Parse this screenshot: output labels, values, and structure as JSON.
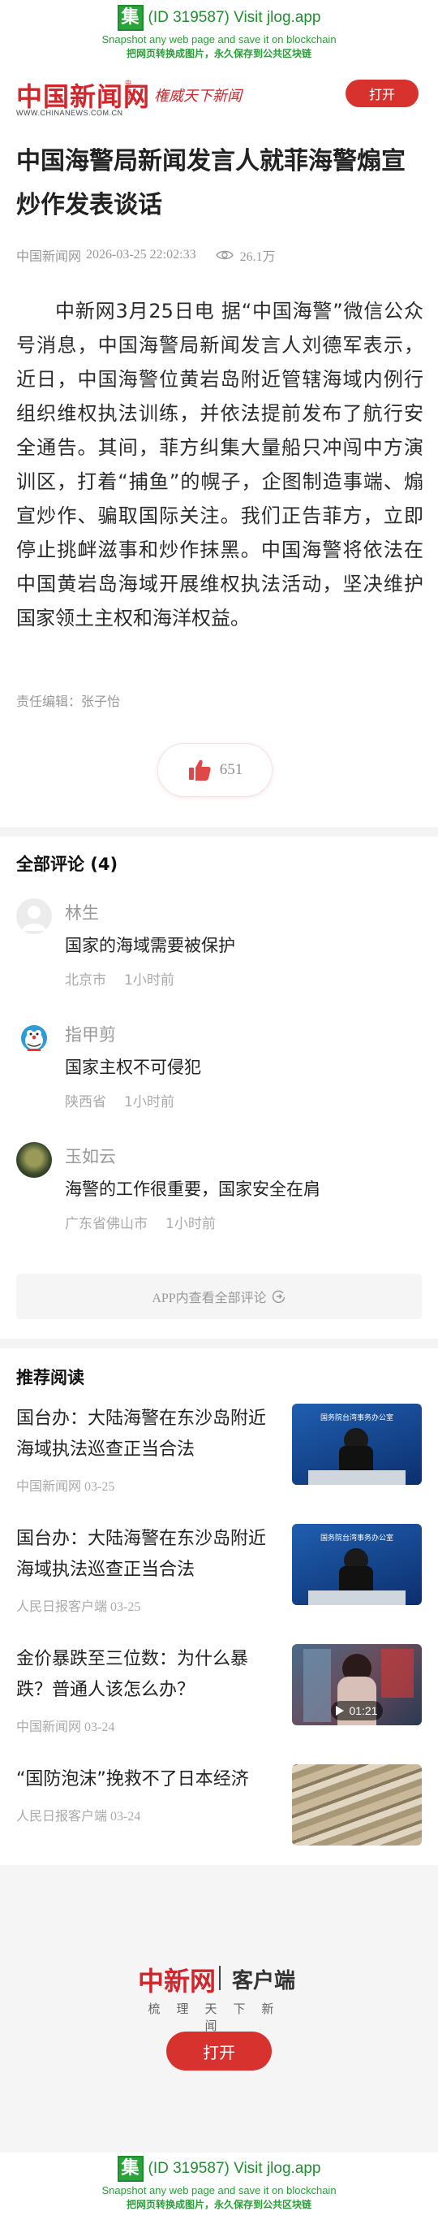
{
  "jlog": {
    "logo_char": "集",
    "id_text": "(ID 319587) Visit jlog.app",
    "line1": "Snapshot any web page and save it on blockchain",
    "line2": "把网页转换成图片，永久保存到公共区块链"
  },
  "header": {
    "logo_text": "中国新闻网",
    "logo_vertical": "中新网",
    "logo_url": "WWW.CHINANEWS.COM.CN",
    "slogan": "権威天下新闻",
    "open_button": "打开"
  },
  "article": {
    "title": "中国海警局新闻发言人就菲海警煽宣炒作发表谈话",
    "source": "中国新闻网",
    "datetime": "2026-03-25 22:02:33",
    "views": "26.1万",
    "body": "中新网3月25日电 据“中国海警”微信公众号消息，中国海警局新闻发言人刘德军表示，近日，中国海警位黄岩岛附近管辖海域内例行组织维权执法训练，并依法提前发布了航行安全通告。其间，菲方纠集大量船只冲闯中方演训区，打着“捕鱼”的幌子，企图制造事端、煽宣炒作、骗取国际关注。我们正告菲方，立即停止挑衅滋事和炒作抹黑。中国海警将依法在中国黄岩岛海域开展维权执法活动，坚决维护国家领土主权和海洋权益。",
    "editor": "责任编辑：张子怡",
    "likes": "651"
  },
  "comments": {
    "header": "全部评论 (4)",
    "items": [
      {
        "name": "林生",
        "text": "国家的海域需要被保护",
        "location": "北京市",
        "time": "1小时前",
        "avatar": "default-avatar"
      },
      {
        "name": "指甲剪",
        "text": "国家主权不可侵犯",
        "location": "陕西省",
        "time": "1小时前",
        "avatar": "cartoon-avatar"
      },
      {
        "name": "玉如云",
        "text": "海警的工作很重要，国家安全在肩",
        "location": "广东省佛山市",
        "time": "1小时前",
        "avatar": "photo-avatar"
      }
    ],
    "view_all": "APP内查看全部评论"
  },
  "recommend": {
    "header": "推荐阅读",
    "items": [
      {
        "title": "国台办：大陆海警在东沙岛附近海域执法巡查正当合法",
        "source": "中国新闻网 03-25",
        "thumb_caption": "国务院台湾事务办公室"
      },
      {
        "title": "国台办：大陆海警在东沙岛附近海域执法巡查正当合法",
        "source": "人民日报客户端 03-25",
        "thumb_caption": "国务院台湾事务办公室"
      },
      {
        "title": "金价暴跌至三位数：为什么暴跌？普通人该怎么办？",
        "source": "中国新闻网 03-24",
        "duration": "01:21"
      },
      {
        "title": "“国防泡沫”挽救不了日本经济",
        "source": "人民日报客户端 03-24"
      }
    ]
  },
  "footer": {
    "logo": "中新网",
    "client": "客户端",
    "tagline": "梳理天下新闻",
    "open_button": "打开"
  },
  "colors": {
    "brand_red": "#d0262c",
    "jlog_green": "#2aa43a"
  }
}
